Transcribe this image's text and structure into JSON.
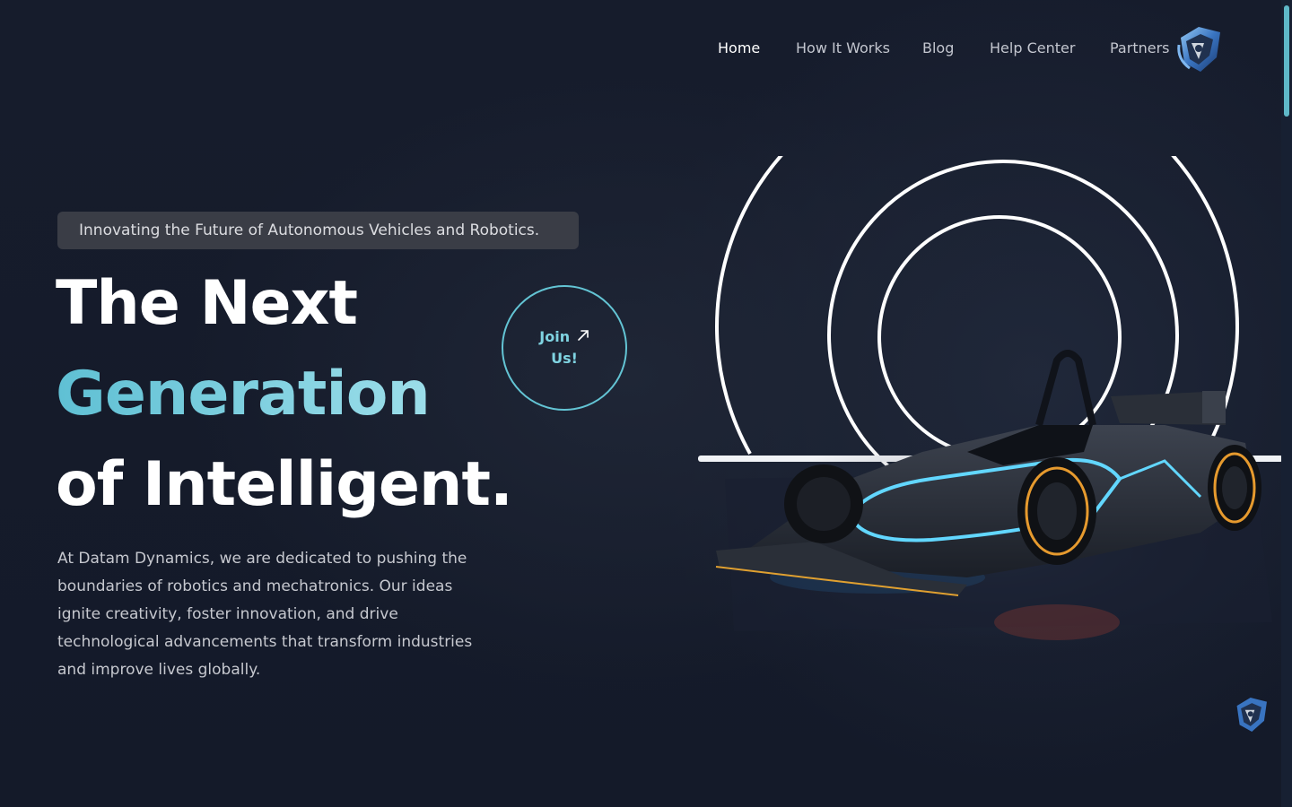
{
  "nav": {
    "items": [
      {
        "label": "Home",
        "active": true
      },
      {
        "label": "How It Works"
      },
      {
        "label": "Blog"
      },
      {
        "label": "Help Center"
      },
      {
        "label": "Partners"
      }
    ],
    "logo_icon": "datam-dynamics-logo-icon"
  },
  "hero": {
    "tagline": "Innovating the Future of Autonomous Vehicles and Robotics.",
    "headline": {
      "line1": "The Next",
      "line2": "Generation",
      "line3": "of Intelligent."
    },
    "description": "At Datam Dynamics, we are dedicated to pushing the boundaries of robotics and mechatronics. Our ideas ignite creativity, foster innovation, and drive technological advancements that transform industries and improve lives globally.",
    "cta": {
      "label_line1": "Join",
      "label_line2": "Us!",
      "icon": "arrow-up-right-icon"
    },
    "image": {
      "subject": "race-car-icon",
      "decor": "concentric-rings"
    }
  },
  "colors": {
    "background": "#151b2b",
    "accent": "#63c4d4",
    "accent_light": "#a9e4ee",
    "tagline_bg": "#3a3d46",
    "body_text": "#c6c8cf"
  }
}
